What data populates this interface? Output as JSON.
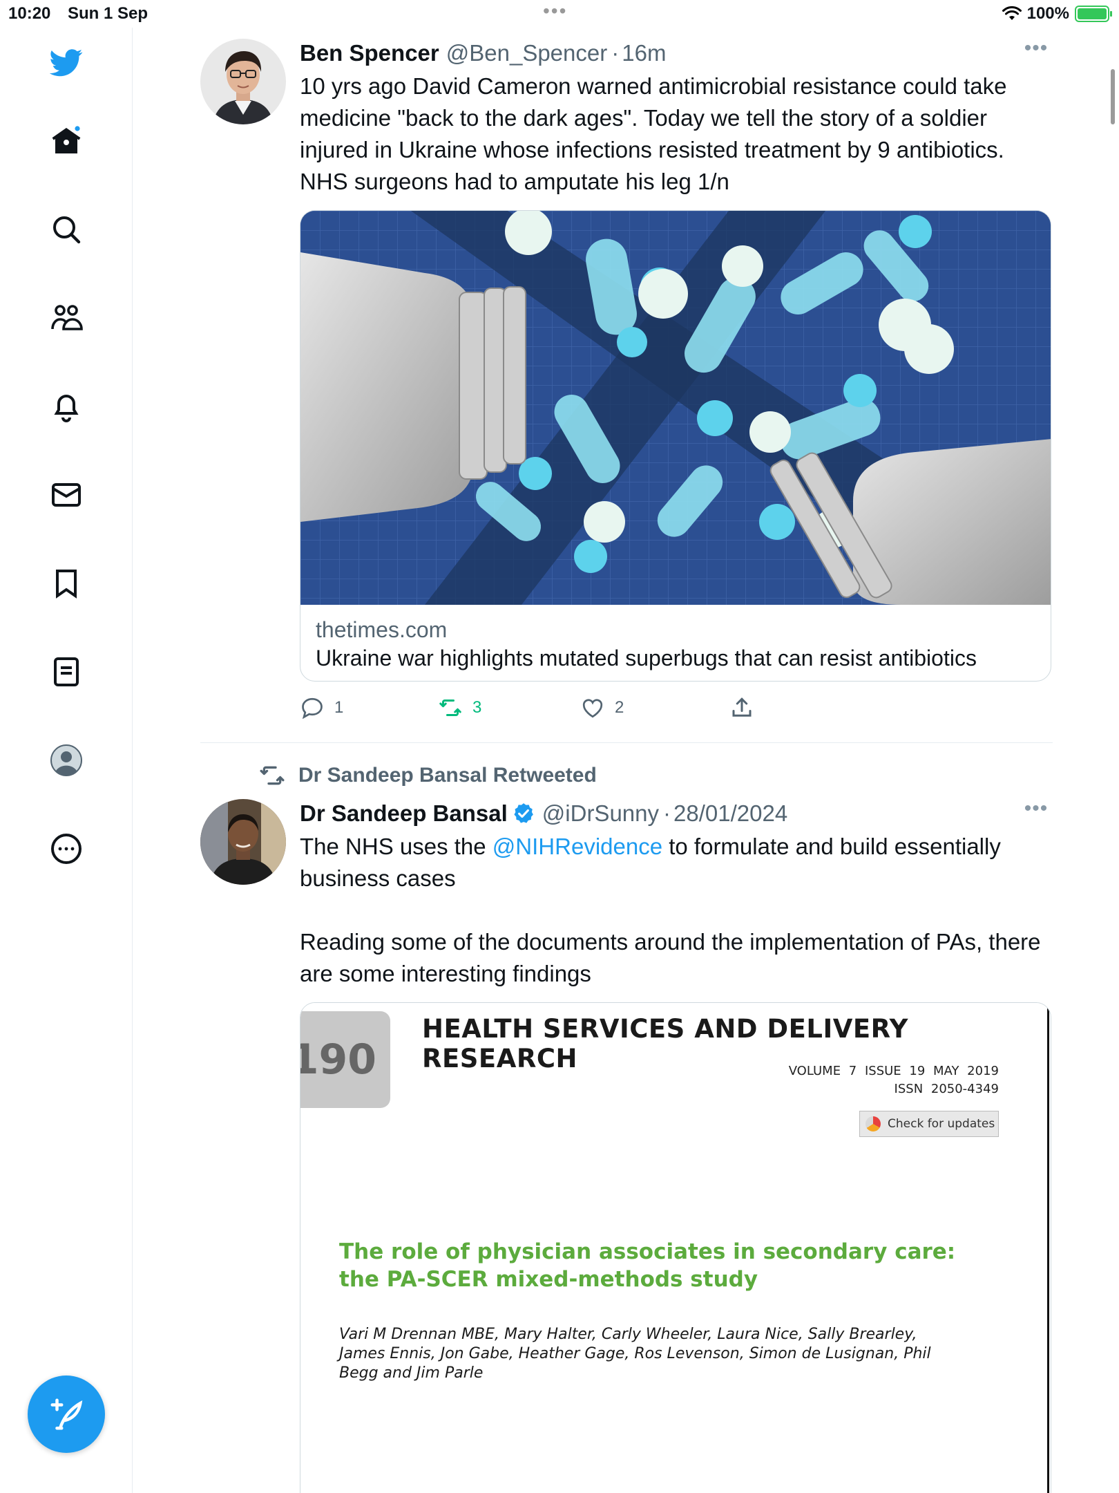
{
  "status_bar": {
    "time": "10:20",
    "date": "Sun 1 Sep",
    "multitask": "•••",
    "battery": "100%",
    "battery_level": 1.0
  },
  "sidebar": {
    "items": [
      {
        "name": "twitter-logo-icon"
      },
      {
        "name": "home-icon"
      },
      {
        "name": "search-icon"
      },
      {
        "name": "communities-icon"
      },
      {
        "name": "notifications-icon"
      },
      {
        "name": "messages-icon"
      },
      {
        "name": "bookmarks-icon"
      },
      {
        "name": "lists-icon"
      },
      {
        "name": "profile-icon"
      },
      {
        "name": "more-icon"
      }
    ],
    "compose_icon": "compose-tweet-icon"
  },
  "colors": {
    "accent": "#1d9bf0",
    "retweet_green": "#00ba7c",
    "secondary_text": "#536471",
    "doc_title_green": "#5cab3d"
  },
  "tweets": [
    {
      "author_name": "Ben Spencer",
      "handle": "@Ben_Spencer",
      "separator": "·",
      "time": "16m",
      "more": "•••",
      "text": "10 yrs ago David Cameron warned  antimicrobial resistance could take medicine \"back to the dark ages\". Today we tell the story of a soldier injured in Ukraine whose infections resisted treatment by 9 antibiotics. NHS surgeons had to amputate his leg  1/n",
      "card": {
        "domain": "thetimes.com",
        "title": "Ukraine war highlights mutated superbugs that can resist antibiotics"
      },
      "actions": {
        "replies": "1",
        "retweets": "3",
        "likes": "2"
      }
    },
    {
      "retweeted_by": "Dr Sandeep Bansal Retweeted",
      "author_name": "Dr Sandeep Bansal",
      "handle": "@iDrSunny",
      "separator": "·",
      "time": "28/01/2024",
      "more": "•••",
      "text_before_mention": "The NHS uses the ",
      "mention": "@NIHRevidence",
      "text_after_mention": " to formulate and build essentially business cases",
      "text_paragraph_2": "Reading some of the documents around the implementation of PAs, there are some interesting findings",
      "document": {
        "tab_number": "190",
        "journal": "HEALTH SERVICES AND DELIVERY RESEARCH",
        "volume_line": "VOLUME 7   ISSUE 19   MAY 2019",
        "issn": "ISSN 2050-4349",
        "check_updates": "Check for updates",
        "title_line_1": "The role of physician associates in secondary care:",
        "title_line_2": "the PA-SCER mixed-methods study",
        "authors": "Vari M Drennan MBE, Mary Halter, Carly Wheeler, Laura Nice, Sally Brearley, James Ennis, Jon Gabe, Heather Gage, Ros Levenson, Simon de Lusignan, Phil Begg and Jim Parle"
      }
    }
  ]
}
